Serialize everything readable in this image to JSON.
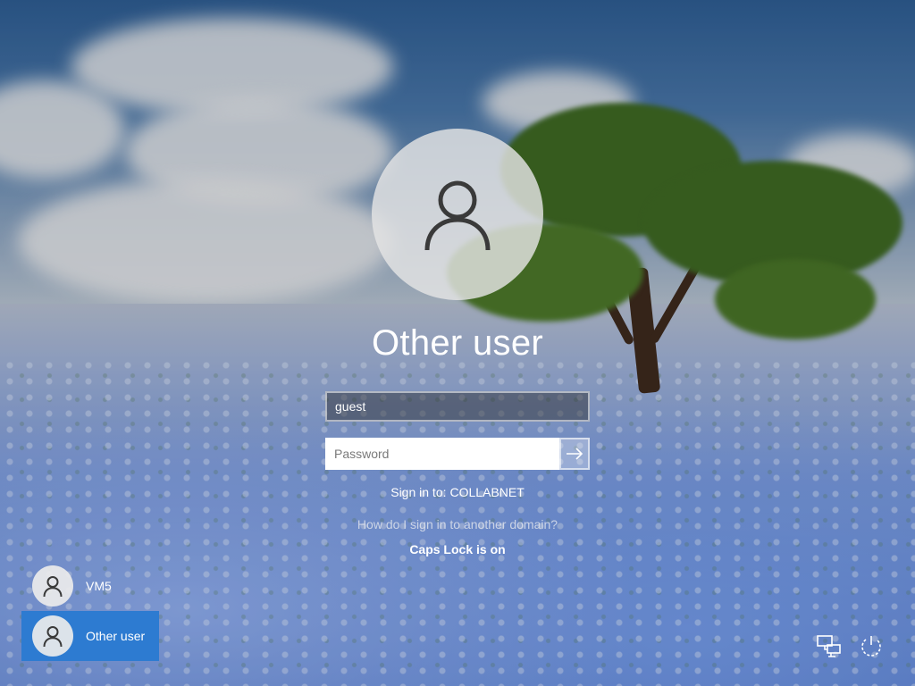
{
  "login": {
    "title": "Other user",
    "username_value": "guest",
    "password_placeholder": "Password",
    "sign_in_to_label": "Sign in to:",
    "domain_name": "COLLABNET",
    "other_domain_link": "How do I sign in to another domain?",
    "caps_lock_warning": "Caps Lock is on"
  },
  "users": [
    {
      "name": "VM5",
      "selected": false
    },
    {
      "name": "Other user",
      "selected": true
    }
  ],
  "system_icons": [
    {
      "name": "network-icon"
    },
    {
      "name": "power-icon"
    }
  ],
  "colors": {
    "selected_tile": "#2d7bd1",
    "text": "#ffffff"
  }
}
